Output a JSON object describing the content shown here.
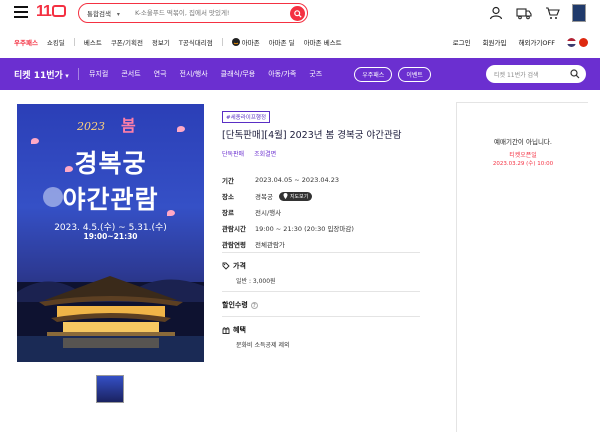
{
  "header": {
    "logo": "11",
    "search": {
      "category": "통합검색",
      "placeholder": "K-소울푸드 떡볶이, 집에서 맛있게!"
    },
    "icons": [
      "user-icon",
      "truck-icon",
      "cart-icon"
    ]
  },
  "subnav": {
    "brand": "우주패스",
    "items": [
      "쇼킹딜",
      "베스트",
      "쿠폰/기획전",
      "정보기",
      "T공식대리점"
    ],
    "amazon": [
      "아마존",
      "아마존 딜",
      "아마존 베스트"
    ],
    "right": [
      "로그인",
      "회원가입",
      "해외가기OFF"
    ]
  },
  "ticketbar": {
    "title": "티켓 11번가",
    "menu": [
      "뮤지컬",
      "콘서트",
      "연극",
      "전시/행사",
      "클래식/무용",
      "아동/가족",
      "굿즈"
    ],
    "pills": [
      "우주패스",
      "이벤트"
    ],
    "search_placeholder": "티켓 11번가 검색"
  },
  "poster": {
    "year": "2023",
    "spring": "봄",
    "line1": "경복궁",
    "line2": "야간관람",
    "dates": "2023. 4.5.(수) ~ 5.31.(수)",
    "time": "19:00~21:30"
  },
  "product": {
    "badge": "#세종라이프행정",
    "title": "[단독판매][4월] 2023년 봄 경복궁 야간관람",
    "tags": [
      "단독판매",
      "조회결면"
    ],
    "details": [
      {
        "k": "기간",
        "v": "2023.04.05 ~ 2023.04.23"
      },
      {
        "k": "장소",
        "v": "경복궁",
        "map": "지도보기"
      },
      {
        "k": "장르",
        "v": "전시/행사"
      },
      {
        "k": "관람시간",
        "v": "19:00 ~ 21:30 (20:30 입장마감)"
      },
      {
        "k": "관람연령",
        "v": "전체관람가"
      }
    ],
    "price_head": "가격",
    "price_value": "일반 : 3,000원",
    "discount_head": "할인수령",
    "benefit_head": "혜택",
    "benefit_value": "문화비 소득공제 제외"
  },
  "sidebar": {
    "message": "예매기간이 아닙니다.",
    "open_label": "티켓오픈일",
    "open_date": "2023.03.29 (수) 10:00"
  }
}
